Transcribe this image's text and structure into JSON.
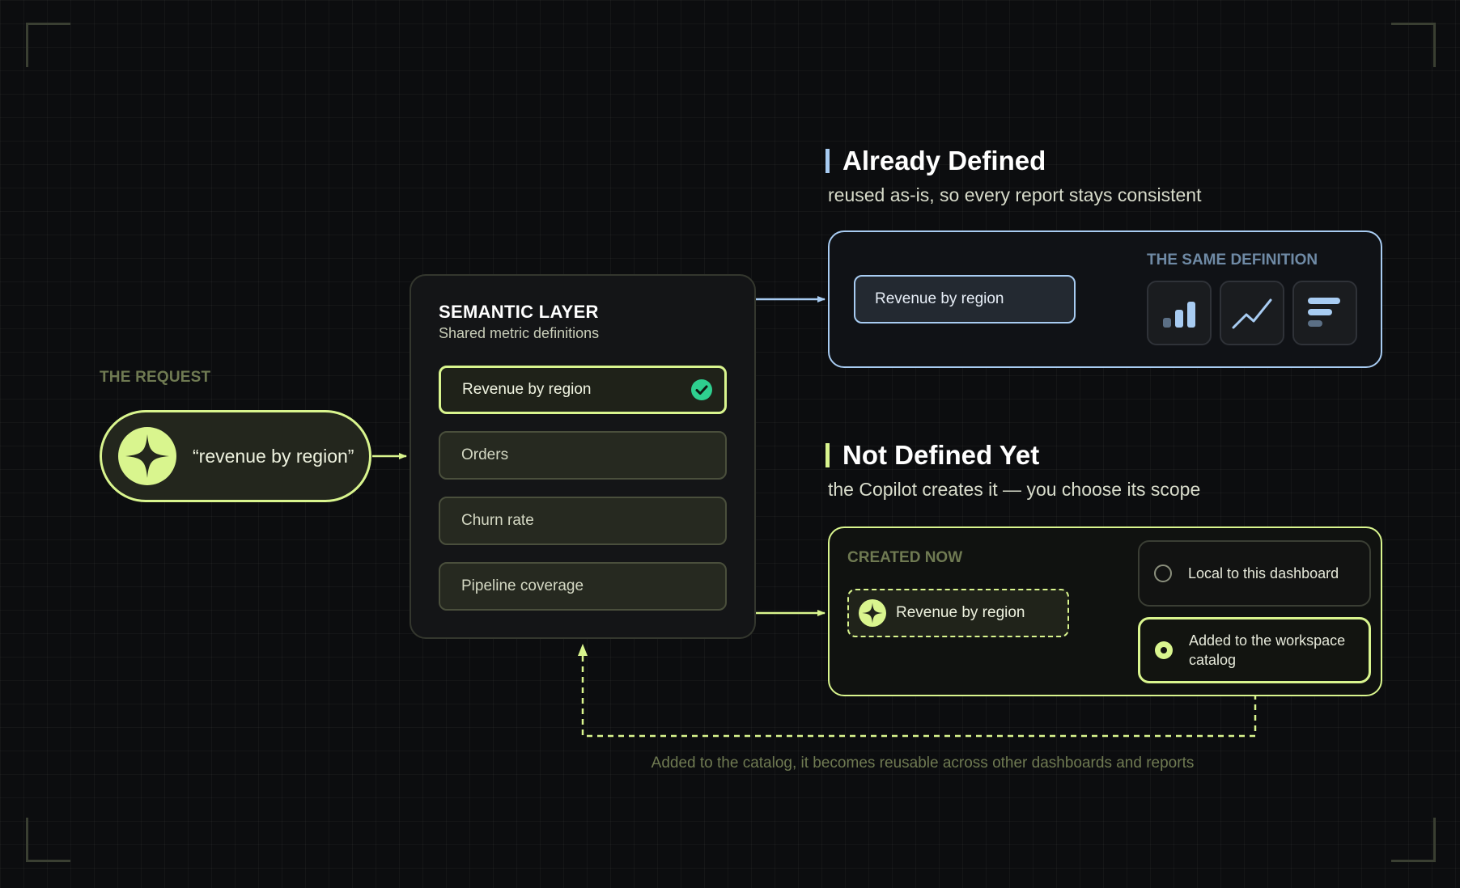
{
  "request": {
    "label": "THE REQUEST",
    "query": "“revenue by region”"
  },
  "semantic_layer": {
    "title": "SEMANTIC LAYER",
    "subtitle": "Shared metric definitions",
    "metrics": [
      {
        "label": "Revenue by region",
        "matched": true
      },
      {
        "label": "Orders",
        "matched": false
      },
      {
        "label": "Churn rate",
        "matched": false
      },
      {
        "label": "Pipeline coverage",
        "matched": false
      }
    ]
  },
  "already_defined": {
    "heading": "Already Defined",
    "subheading": "reused as-is, so every report stays consistent",
    "metric": "Revenue by region",
    "same_label": "THE SAME DEFINITION",
    "visualizations": [
      "bar-chart-icon",
      "line-chart-icon",
      "horizontal-bar-icon"
    ]
  },
  "not_defined": {
    "heading": "Not Defined Yet",
    "subheading": "the Copilot creates it — you choose its scope",
    "created_label": "CREATED NOW",
    "metric": "Revenue by region",
    "options": [
      {
        "label": "Local to this dashboard",
        "selected": false
      },
      {
        "label": "Added to the workspace catalog",
        "selected": true
      }
    ]
  },
  "footnote": "Added to the catalog, it becomes reusable across other dashboards and reports",
  "colors": {
    "lime": "#d9f58e",
    "blue": "#a8ccf2",
    "olive": "#6f7a52",
    "green_check": "#2ecf8f",
    "background": "#0c0d0f"
  }
}
